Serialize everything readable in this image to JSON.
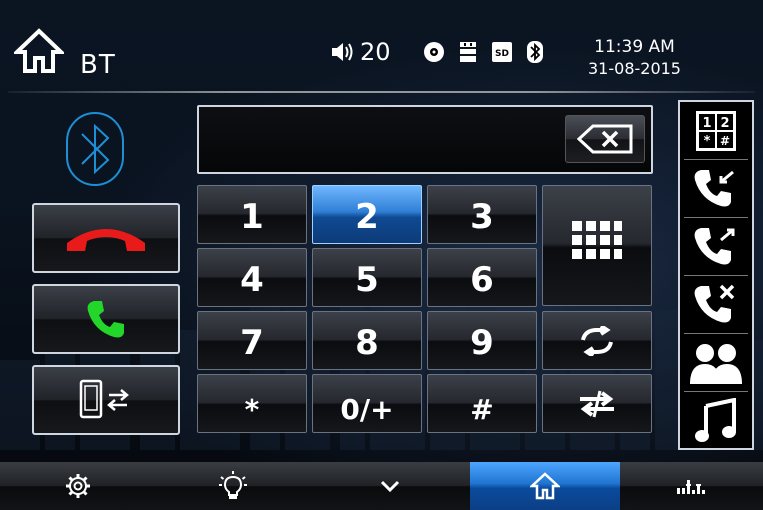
{
  "header": {
    "title": "BT",
    "volume": "20",
    "time": "11:39 AM",
    "date": "31-08-2015",
    "icons": [
      "home-icon",
      "speaker-icon",
      "disc-icon",
      "usb-icon",
      "sd-card-icon",
      "bluetooth-icon"
    ]
  },
  "left": {
    "logo": "bluetooth-icon",
    "buttons": [
      "end-call",
      "answer-call",
      "transfer-audio"
    ]
  },
  "display": {
    "number": "",
    "backspace_icon": "backspace-icon"
  },
  "keypad": {
    "keys": [
      "1",
      "2",
      "3",
      "4",
      "5",
      "6",
      "7",
      "8",
      "9",
      "*",
      "0/+",
      "#"
    ],
    "active_key": "2",
    "extra_buttons": [
      "keypad-grid-icon",
      "redial-icon",
      "swap-icon"
    ]
  },
  "right_menu": [
    "dial-pad-icon",
    "incoming-calls-icon",
    "outgoing-calls-icon",
    "missed-calls-icon",
    "contacts-icon",
    "music-icon"
  ],
  "bottom_bar": [
    "settings-icon",
    "brightness-icon",
    "chevron-down-icon",
    "home-icon",
    "equalizer-icon"
  ],
  "bottom_active": "home",
  "colors": {
    "accent": "#2f7fd6",
    "end_call": "#e81a1a",
    "answer_call": "#22d62a",
    "bluetooth": "#1d8fd6"
  }
}
